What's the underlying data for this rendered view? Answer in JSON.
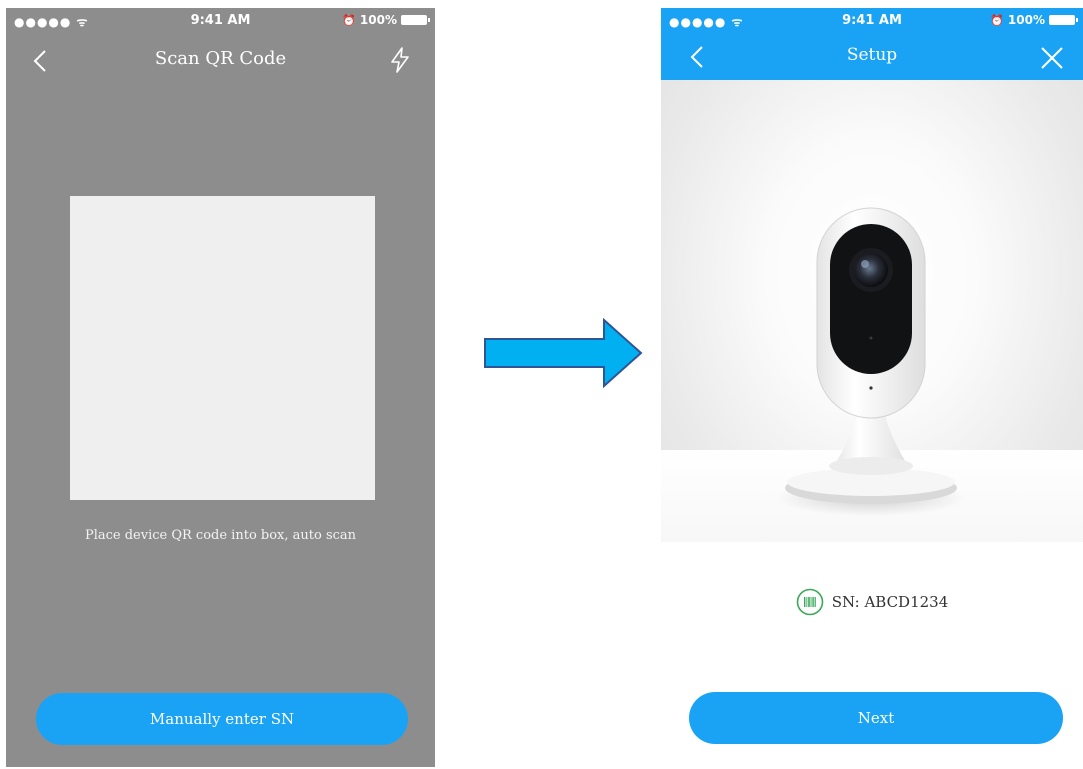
{
  "left_screen": {
    "status": {
      "signal": "●●●●● ",
      "time": "9:41 AM",
      "battery": "100%"
    },
    "nav": {
      "title": "Scan QR Code",
      "back_icon": "chevron-left-icon",
      "right_icon": "flash-icon"
    },
    "scan_hint": "Place device QR code into box, auto scan",
    "manual_button_label": "Manually enter SN"
  },
  "arrow": {
    "icon": "right-arrow-icon",
    "color": "#00b0f0",
    "border_color": "#2f5597"
  },
  "right_screen": {
    "status": {
      "signal": "●●●●● ",
      "time": "9:41 AM",
      "battery": "100%"
    },
    "nav": {
      "title": "Setup",
      "back_icon": "chevron-left-icon",
      "close_icon": "close-icon"
    },
    "product_image": "indoor-camera",
    "sn_label": "SN: ABCD1234",
    "next_button_label": "Next"
  },
  "colors": {
    "accent": "#1aa3f5",
    "scanner_background": "#8d8d8d",
    "scan_box": "#efefef",
    "barcode_icon": "#3aa85a"
  }
}
